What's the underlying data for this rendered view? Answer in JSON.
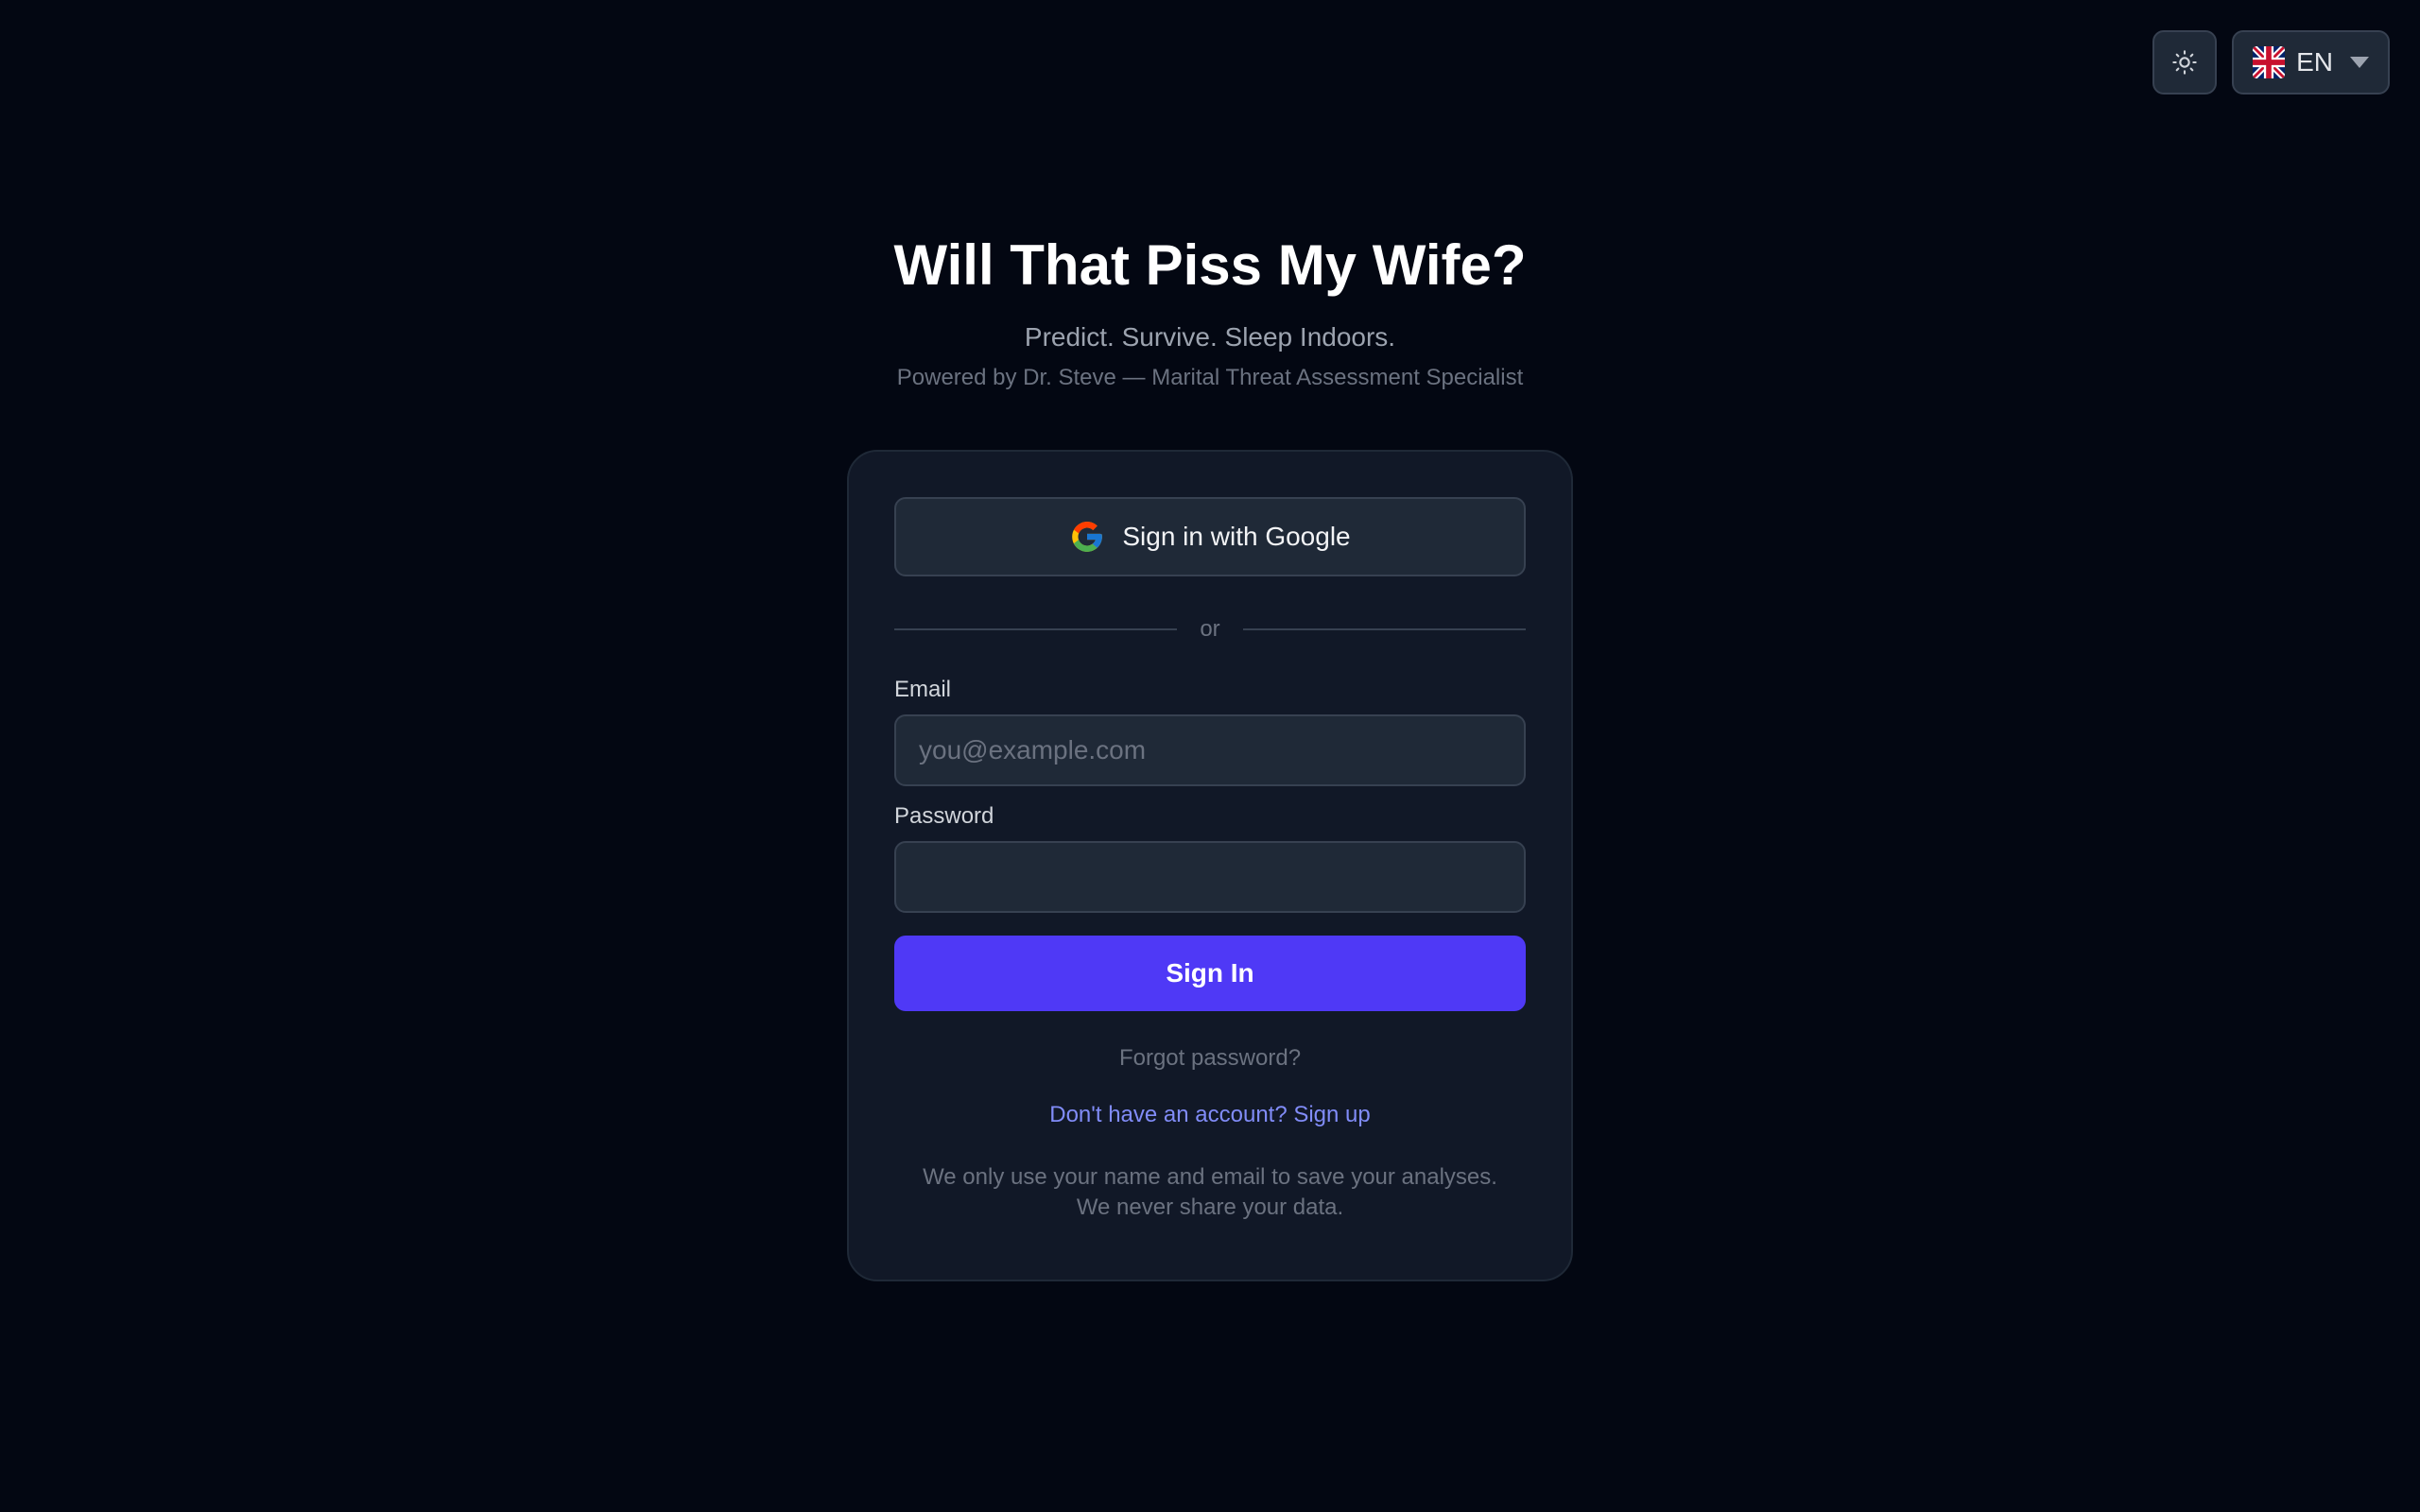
{
  "app": {
    "title": "Will That Piss My Wife?",
    "tagline": "Predict. Survive. Sleep Indoors.",
    "powered_by": "Powered by Dr. Steve — Marital Threat Assessment Specialist"
  },
  "top_controls": {
    "theme_icon": "sun-icon",
    "language": {
      "flag_icon": "uk-flag-icon",
      "selected": "EN"
    }
  },
  "login_card": {
    "google_button_label": "Sign in with Google",
    "divider_text": "or",
    "email": {
      "label": "Email",
      "placeholder": "you@example.com",
      "value": ""
    },
    "password": {
      "label": "Password",
      "placeholder": "",
      "value": ""
    },
    "signin_button_label": "Sign In",
    "forgot_password": "Forgot password?",
    "signup_link": "Don't have an account? Sign up",
    "privacy_line1": "We only use your name and email to save your analyses.",
    "privacy_line2": "We never share your data."
  },
  "colors": {
    "background": "#030712",
    "card": "#111827",
    "accent": "#4f39f6",
    "link": "#818cf8"
  }
}
